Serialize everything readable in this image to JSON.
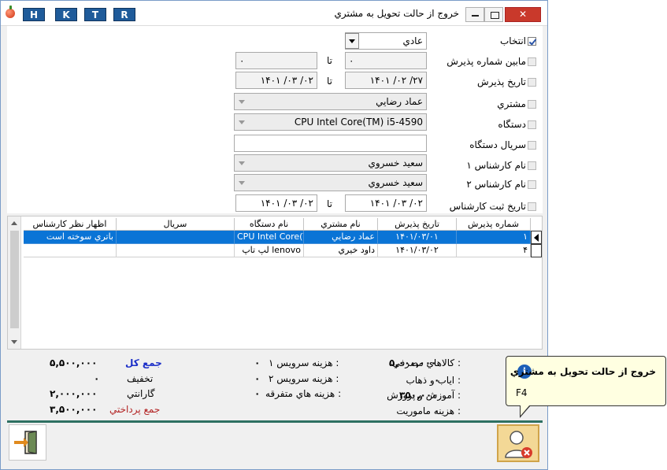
{
  "window": {
    "title": "خروج از حالت تحويل به مشتري"
  },
  "hotkeys": [
    "H",
    "K",
    "T",
    "R"
  ],
  "filters": {
    "select_label": "انتخاب",
    "receipt_no_label": "مابين شماره پذيرش",
    "receipt_date_label": "تاريخ پذيرش",
    "customer_label": "مشتري",
    "device_label": "دستگاه",
    "device_serial_label": "سريال دستگاه",
    "tech1_label": "نام کارشناس ۱",
    "tech2_label": "نام کارشناس ۲",
    "tech_record_date_label": "تاريخ ثبت کارشناس",
    "to_label": "تا",
    "status_value": "عادي",
    "receipt_from": "۰",
    "receipt_to": "۰",
    "date_from": "۲۷/ ۰۲/ ۱۴۰۱",
    "date_to": "۰۲/ ۰۳/ ۱۴۰۱",
    "customer_value": "عماد رضايي",
    "device_value": "CPU Intel Core(TM) i5-4590",
    "serial_value": "",
    "tech1_value": "سعيد خسروي",
    "tech2_value": "سعيد خسروي",
    "tech_date_from": "۰۲/ ۰۳/ ۱۴۰۱",
    "tech_date_to": "۰۲/ ۰۳/ ۱۴۰۱"
  },
  "grid": {
    "columns": [
      "شماره پذيرش",
      "تاريخ پذيرش",
      "نام مشتري",
      "نام دستگاه",
      "سريال",
      "اظهار نظر کارشناس"
    ],
    "rows": [
      {
        "no": "۱",
        "date": "۱۴۰۱/۰۳/۰۱",
        "customer": "عماد رضايي",
        "device": "CPU Intel Core(TM) i5-4590",
        "serial": "",
        "comment": "باتري سوخته است"
      },
      {
        "no": "۴",
        "date": "۱۴۰۱/۰۳/۰۲",
        "customer": "داود خيري",
        "device": "لپ تاپ lenovo",
        "serial": "",
        "comment": ""
      }
    ]
  },
  "summary": {
    "parts_label": "کالاهاي مصرفي :",
    "parts_value": "۵,۰۰۰,۰۰۰",
    "transport_label": "اياب و ذهاب :",
    "transport_value": "۰",
    "training_label": "آموزش و پرورش :",
    "training_value": "۳۵۰,۰۰۰",
    "mission_label": "هزينه ماموريت :",
    "mission_value": "۰",
    "service1_label": "هزينه سرويس ۱ :",
    "service1_value": "۰",
    "service2_label": "هزينه سرويس ۲ :",
    "service2_value": "۰",
    "misc_label": "هزينه هاي متفرقه :",
    "misc_value": "۰",
    "total_label": "جمع کل",
    "total_value": "۵,۵۰۰,۰۰۰",
    "discount_label": "تخفيف",
    "discount_value": "۰",
    "warranty_label": "گارانتي",
    "warranty_value": "۲,۰۰۰,۰۰۰",
    "payable_label": "جمع پرداختي",
    "payable_value": "۳,۵۰۰,۰۰۰"
  },
  "tooltip": {
    "title": "خروج از حالت تحويل به مشتري",
    "shortcut": "F4"
  },
  "colors": {
    "accent": "#0a74d6",
    "footer_line": "#2e7062",
    "cancel_bg": "#f3d896",
    "tooltip_bg": "#ffffe1",
    "hotkey_bg": "#1f5b9a"
  }
}
